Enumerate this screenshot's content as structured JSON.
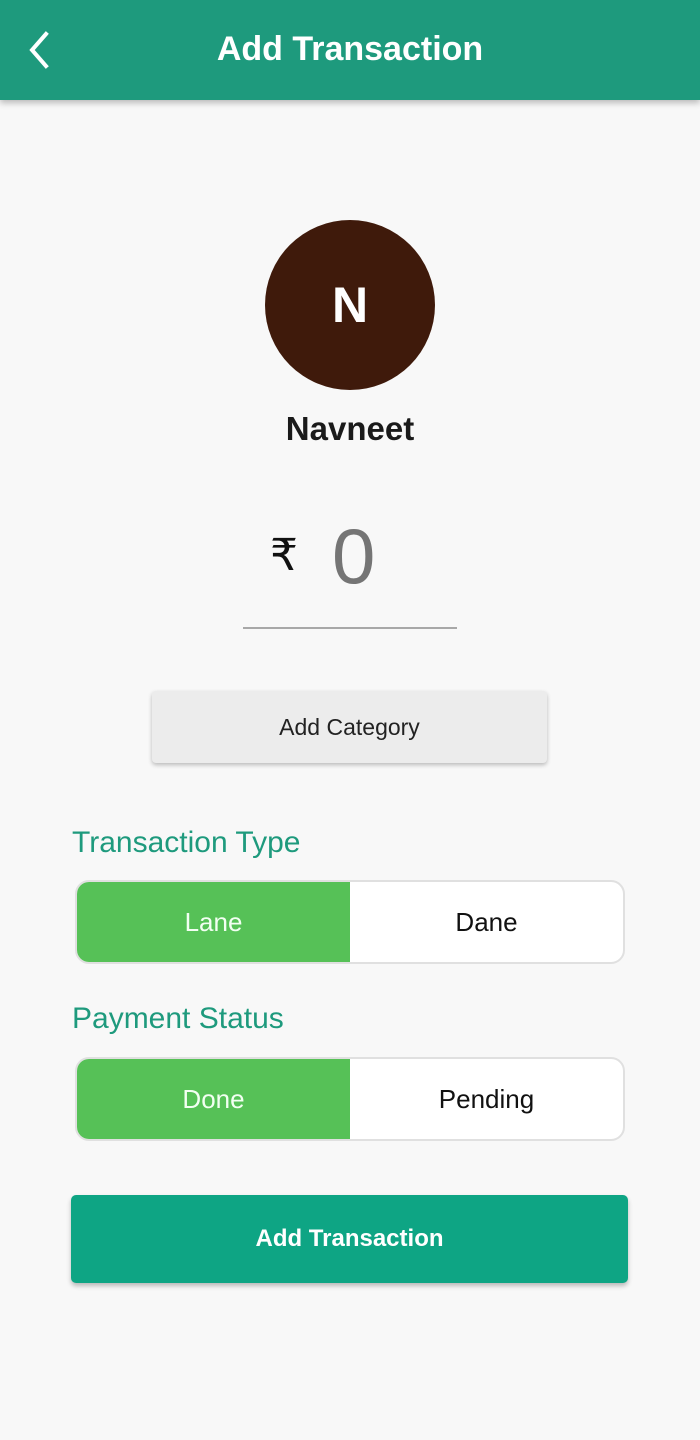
{
  "header": {
    "title": "Add Transaction",
    "back_icon": "chevron-left-icon"
  },
  "contact": {
    "initial": "N",
    "name": "Navneet",
    "avatar_color": "#3f1a0b"
  },
  "amount": {
    "currency_symbol": "₹",
    "placeholder": "0",
    "value": ""
  },
  "category_button": {
    "label": "Add Category"
  },
  "transaction_type": {
    "label": "Transaction Type",
    "options": [
      {
        "label": "Lane",
        "selected": true
      },
      {
        "label": "Dane",
        "selected": false
      }
    ]
  },
  "payment_status": {
    "label": "Payment Status",
    "options": [
      {
        "label": "Done",
        "selected": true
      },
      {
        "label": "Pending",
        "selected": false
      }
    ]
  },
  "submit_button": {
    "label": "Add Transaction"
  },
  "colors": {
    "primary": "#1e9a7d",
    "selected": "#56c157",
    "submit": "#0ea584"
  }
}
